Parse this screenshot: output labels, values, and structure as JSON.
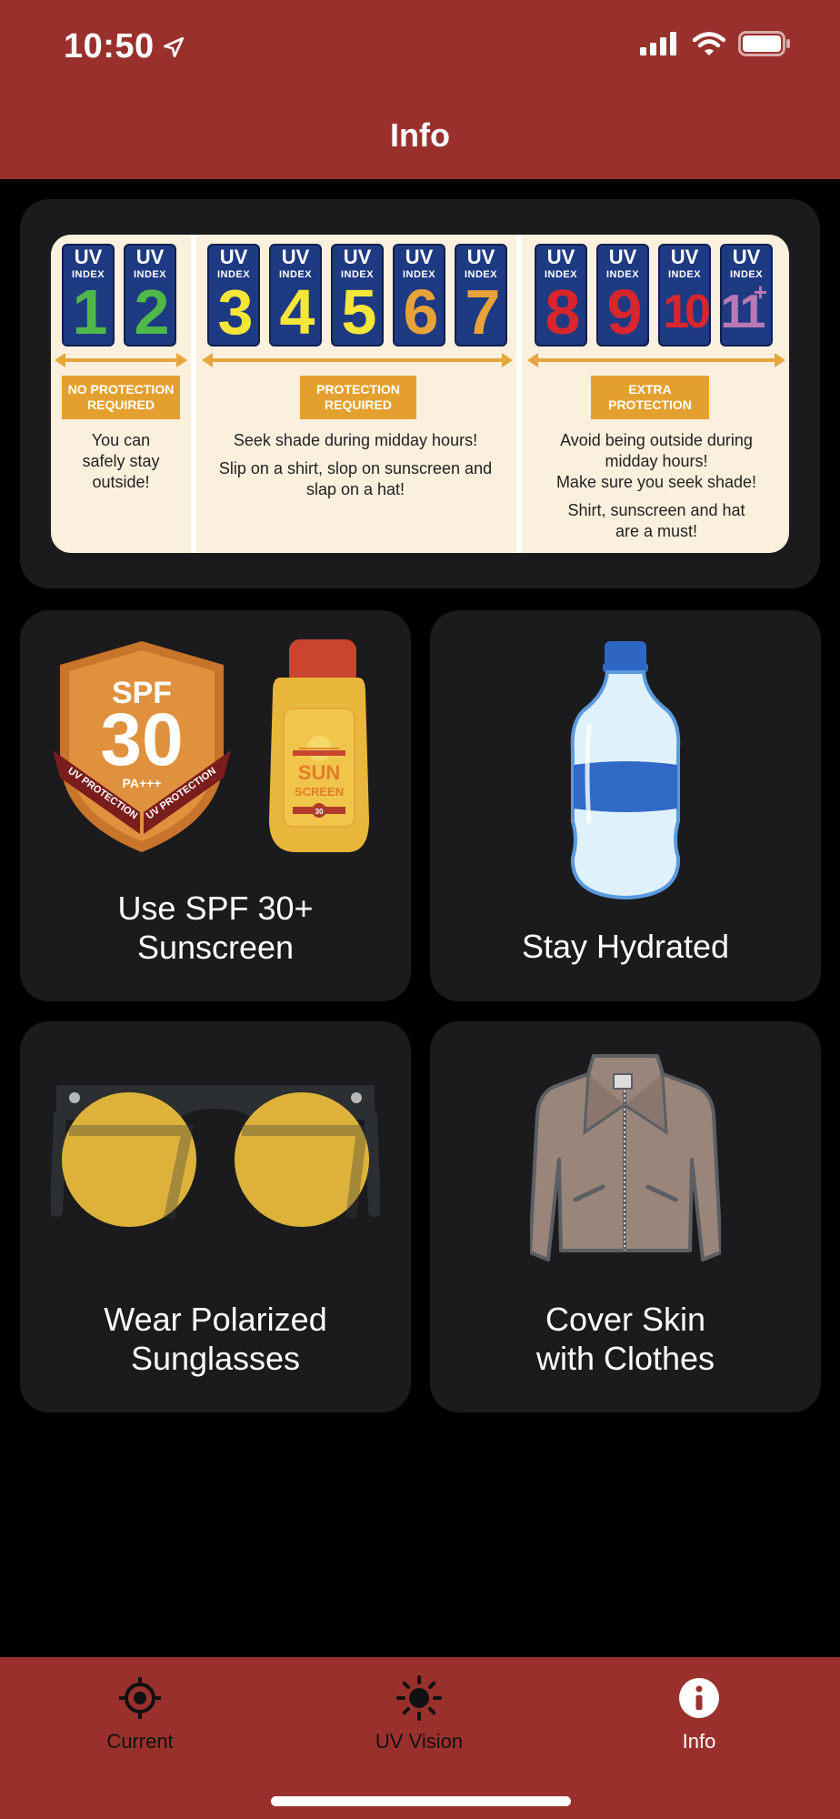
{
  "status_bar": {
    "time": "10:50",
    "icons": [
      "location-arrow-icon",
      "cellular-signal-icon",
      "wifi-icon",
      "battery-icon"
    ]
  },
  "nav": {
    "title": "Info"
  },
  "uv_chart": {
    "boxes": [
      {
        "label": "UV",
        "sub": "INDEX",
        "number": "1",
        "color": "#4fb848"
      },
      {
        "label": "UV",
        "sub": "INDEX",
        "number": "2",
        "color": "#4fb848"
      },
      {
        "label": "UV",
        "sub": "INDEX",
        "number": "3",
        "color": "#f5e63a"
      },
      {
        "label": "UV",
        "sub": "INDEX",
        "number": "4",
        "color": "#f5e63a"
      },
      {
        "label": "UV",
        "sub": "INDEX",
        "number": "5",
        "color": "#f5e63a"
      },
      {
        "label": "UV",
        "sub": "INDEX",
        "number": "6",
        "color": "#e8a23a"
      },
      {
        "label": "UV",
        "sub": "INDEX",
        "number": "7",
        "color": "#e8a23a"
      },
      {
        "label": "UV",
        "sub": "INDEX",
        "number": "8",
        "color": "#d8262c"
      },
      {
        "label": "UV",
        "sub": "INDEX",
        "number": "9",
        "color": "#d8262c"
      },
      {
        "label": "UV",
        "sub": "INDEX",
        "number": "10",
        "color": "#d8262c"
      },
      {
        "label": "UV",
        "sub": "INDEX",
        "number": "11",
        "sup": "+",
        "color": "#b879b5"
      }
    ],
    "groups": [
      {
        "label_line1": "NO PROTECTION",
        "label_line2": "REQUIRED",
        "text": [
          "You can",
          "safely stay",
          "outside!"
        ]
      },
      {
        "label_line1": "PROTECTION",
        "label_line2": "REQUIRED",
        "text": [
          "Seek shade during midday hours!",
          "Slip on a shirt, slop on sunscreen and",
          "slap on a hat!"
        ]
      },
      {
        "label_line1": "EXTRA",
        "label_line2": "PROTECTION",
        "text": [
          "Avoid being outside during",
          "midday hours!",
          "Make sure you seek shade!",
          "Shirt, sunscreen and hat",
          "are a must!"
        ]
      }
    ]
  },
  "tiles": {
    "sunscreen": {
      "caption_line1": "Use SPF 30+",
      "caption_line2": "Sunscreen",
      "badge_spf": "SPF",
      "badge_number": "30",
      "badge_pa": "PA+++",
      "ribbon_left": "UV PROTECTION",
      "ribbon_right": "UV PROTECTION",
      "bottle_line1": "SUN",
      "bottle_line2": "SCREEN",
      "bottle_number": "30"
    },
    "hydrated": {
      "caption_line1": "Stay Hydrated"
    },
    "sunglasses": {
      "caption_line1": "Wear Polarized",
      "caption_line2": "Sunglasses"
    },
    "clothes": {
      "caption_line1": "Cover Skin",
      "caption_line2": "with Clothes"
    }
  },
  "tabbar": {
    "tabs": [
      {
        "label": "Current",
        "icon": "location-target-icon",
        "active": false
      },
      {
        "label": "UV Vision",
        "icon": "sun-icon",
        "active": false
      },
      {
        "label": "Info",
        "icon": "info-circle-icon",
        "active": true
      }
    ]
  },
  "colors": {
    "header": "#9a302c",
    "card": "#1b1b1d",
    "chart_bg": "#fbf0dd",
    "label_orange": "#e4a02f",
    "uv_box_blue": "#1e3a82"
  }
}
